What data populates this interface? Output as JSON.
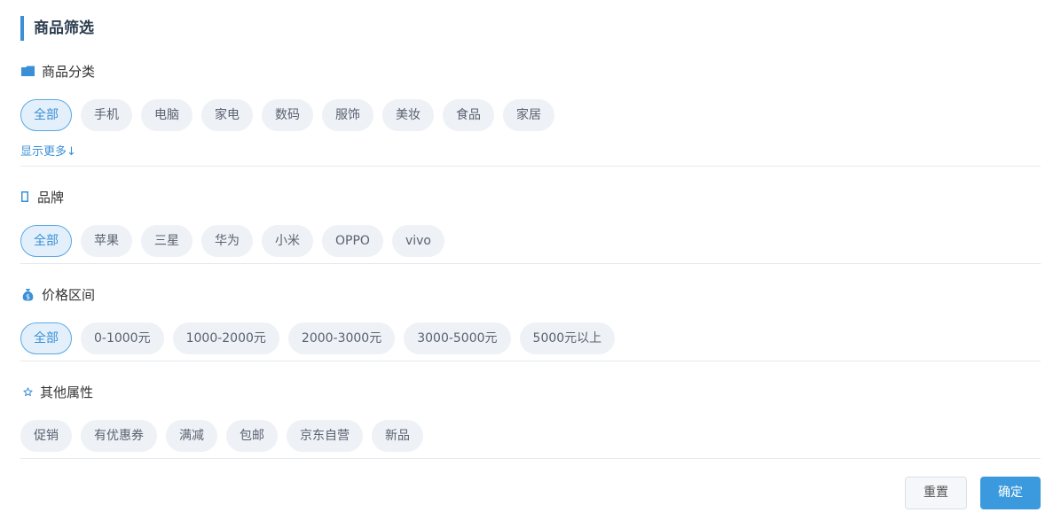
{
  "title": "商品筛选",
  "sections": {
    "category": {
      "icon": "folder-icon",
      "label": "商品分类",
      "tags": [
        "全部",
        "手机",
        "电脑",
        "家电",
        "数码",
        "服饰",
        "美妆",
        "食品",
        "家居"
      ],
      "more": "显示更多↓"
    },
    "brand": {
      "icon": "brand-icon",
      "label": "品牌",
      "tags": [
        "全部",
        "苹果",
        "三星",
        "华为",
        "小米",
        "OPPO",
        "vivo"
      ]
    },
    "price": {
      "icon": "money-bag-icon",
      "label": "价格区间",
      "tags": [
        "全部",
        "0-1000元",
        "1000-2000元",
        "2000-3000元",
        "3000-5000元",
        "5000元以上"
      ]
    },
    "other": {
      "icon": "star-icon",
      "label": "其他属性",
      "tags": [
        "促销",
        "有优惠券",
        "满减",
        "包邮",
        "京东自营",
        "新品"
      ]
    }
  },
  "buttons": {
    "reset": "重置",
    "confirm": "确定"
  },
  "colors": {
    "accent": "#3b8fd6",
    "confirm_bg": "#3b9ade",
    "tag_bg": "#eef1f6"
  }
}
